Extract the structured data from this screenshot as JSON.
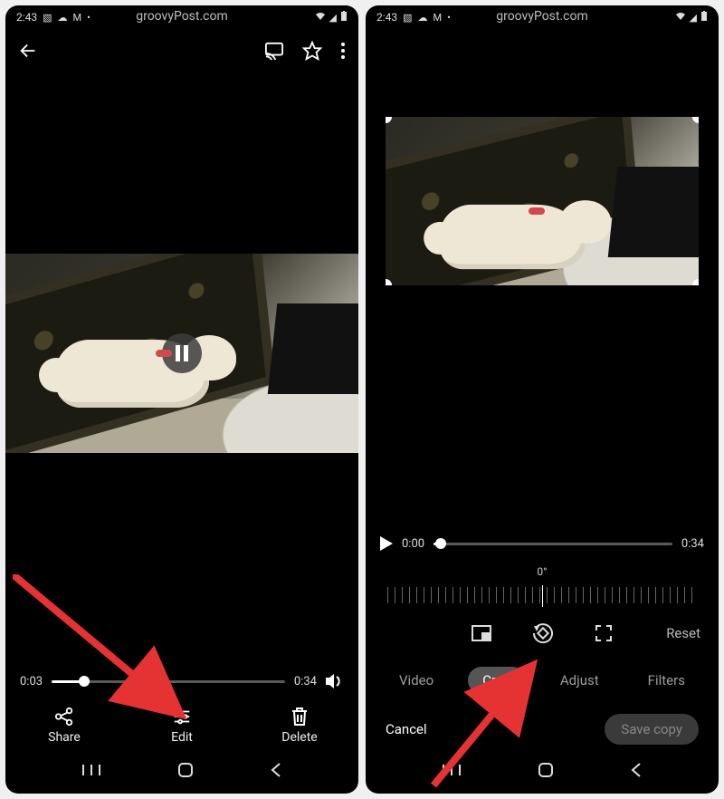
{
  "status": {
    "time": "2:43",
    "brand": "groovyPost.com"
  },
  "left": {
    "playback": {
      "current": "0:03",
      "total": "0:34",
      "fill_percent": 14
    },
    "actions": {
      "share": "Share",
      "edit": "Edit",
      "delete": "Delete"
    }
  },
  "right": {
    "playback": {
      "current": "0:00",
      "total": "0:34",
      "fill_percent": 3
    },
    "rotation": "0°",
    "reset_label": "Reset",
    "tabs": {
      "video": "Video",
      "crop": "Crop",
      "adjust": "Adjust",
      "filters": "Filters"
    },
    "cancel": "Cancel",
    "save": "Save copy"
  }
}
